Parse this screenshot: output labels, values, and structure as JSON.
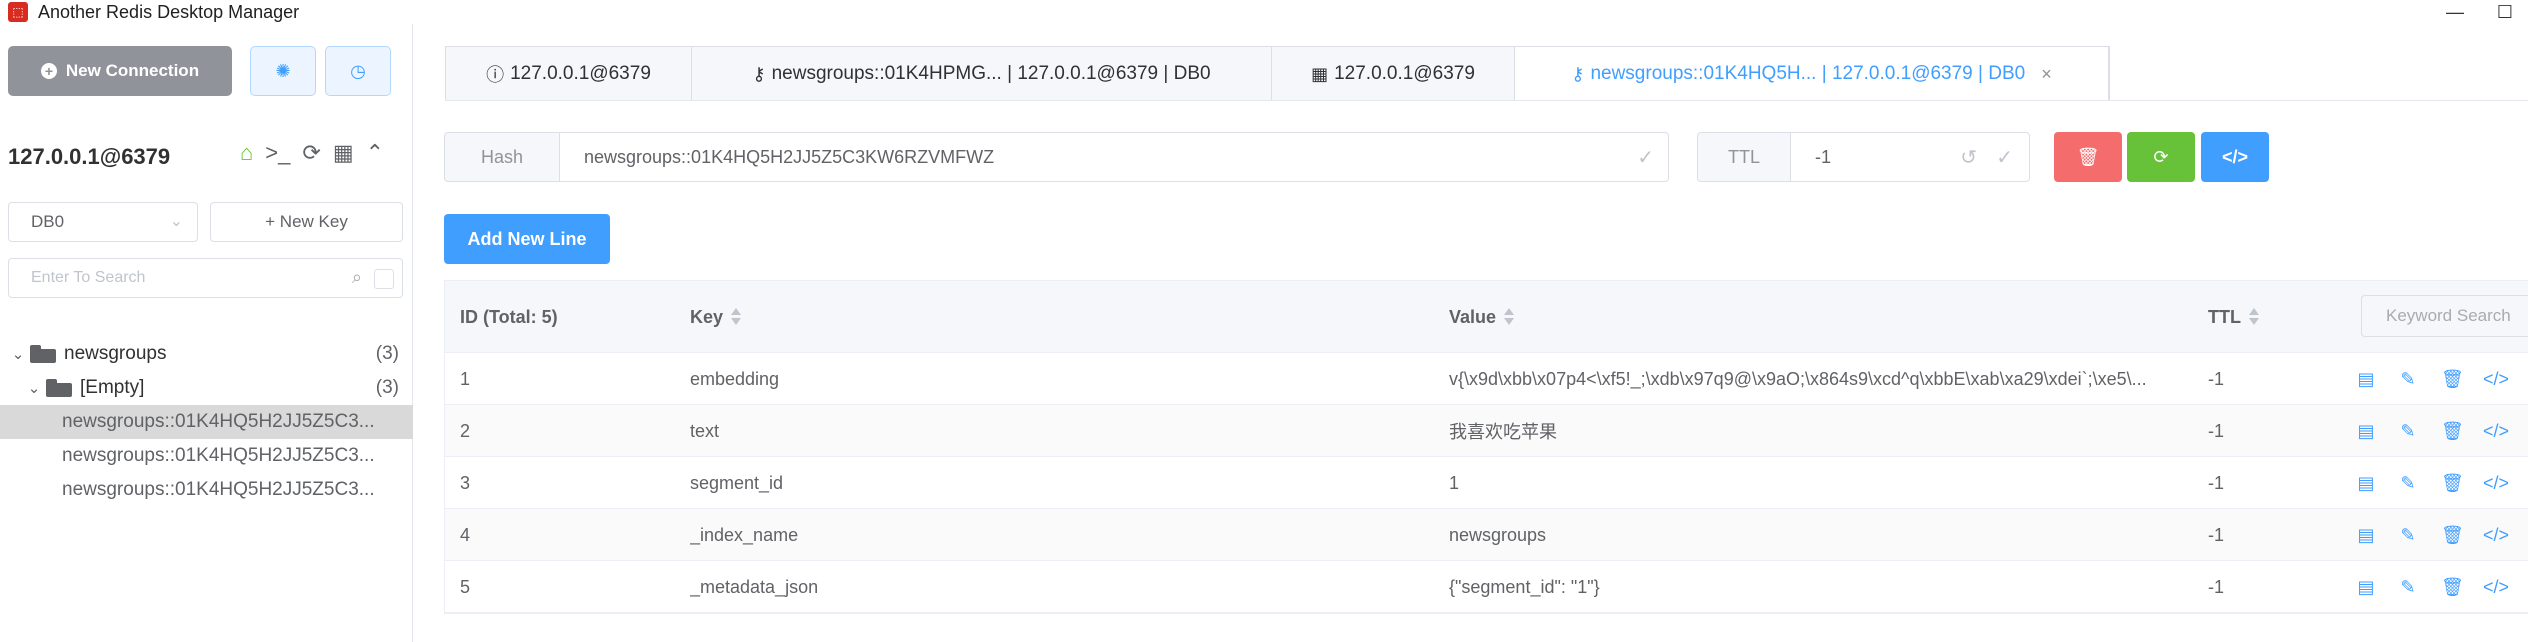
{
  "window": {
    "title": "Another Redis Desktop Manager",
    "minimize": "—",
    "maximize": "☐"
  },
  "sidebar": {
    "new_connection_label": "New Connection",
    "connection_name": "127.0.0.1@6379",
    "db_value": "DB0",
    "new_key_label": "+ New Key",
    "search_placeholder": "Enter To Search",
    "tree": {
      "root": {
        "label": "newsgroups",
        "count": "(3)"
      },
      "child": {
        "label": "[Empty]",
        "count": "(3)"
      },
      "keys": [
        "newsgroups::01K4HQ5H2JJ5Z5C3...",
        "newsgroups::01K4HQ5H2JJ5Z5C3...",
        "newsgroups::01K4HQ5H2JJ5Z5C3..."
      ]
    }
  },
  "tabs": [
    {
      "icon": "info-icon",
      "label": "127.0.0.1@6379"
    },
    {
      "icon": "key-icon",
      "label": "newsgroups::01K4HPMG... | 127.0.0.1@6379 | DB0"
    },
    {
      "icon": "table-icon",
      "label": "127.0.0.1@6379"
    },
    {
      "icon": "key-icon",
      "label": "newsgroups::01K4HQ5H... | 127.0.0.1@6379 | DB0",
      "active": true
    }
  ],
  "keybar": {
    "type_label": "Hash",
    "key_name": "newsgroups::01K4HQ5H2JJ5Z5C3KW6RZVMFWZ",
    "ttl_label": "TTL",
    "ttl_value": "-1"
  },
  "add_new_line_label": "Add New Line",
  "table": {
    "headers": {
      "id": "ID (Total: 5)",
      "key": "Key",
      "value": "Value",
      "ttl": "TTL"
    },
    "keyword_search_placeholder": "Keyword Search",
    "rows": [
      {
        "id": "1",
        "key": "embedding",
        "value": "v{\\x9d\\xbb\\x07p4<\\xf5!_;\\xdb\\x97q9@\\x9aO;\\x864s9\\xcd^q\\xbbE\\xab\\xa29\\xdei`;\\xe5\\...",
        "ttl": "-1"
      },
      {
        "id": "2",
        "key": "text",
        "value": "我喜欢吃苹果",
        "ttl": "-1"
      },
      {
        "id": "3",
        "key": "segment_id",
        "value": "1",
        "ttl": "-1"
      },
      {
        "id": "4",
        "key": "_index_name",
        "value": "newsgroups",
        "ttl": "-1"
      },
      {
        "id": "5",
        "key": "_metadata_json",
        "value": "{\"segment_id\": \"1\"}",
        "ttl": "-1"
      }
    ]
  },
  "colors": {
    "primary": "#409eff",
    "danger": "#f56c6c",
    "success": "#67c23a",
    "neutral": "#909399"
  }
}
